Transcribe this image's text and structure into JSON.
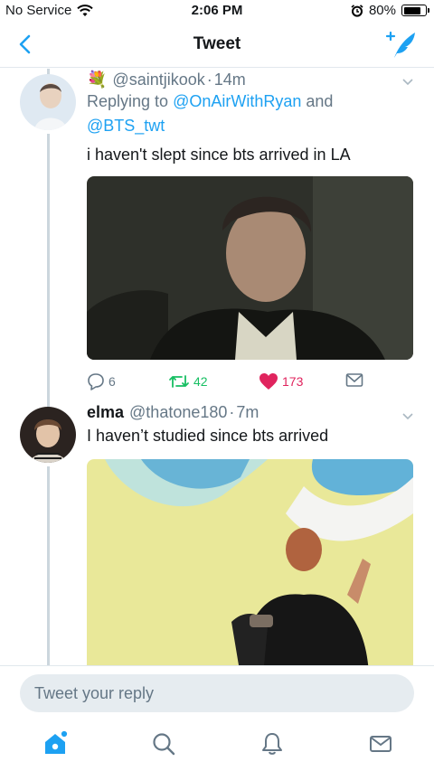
{
  "status_bar": {
    "carrier": "No Service",
    "time": "2:06 PM",
    "battery": "80%",
    "battery_level": 0.8
  },
  "header": {
    "title": "Tweet"
  },
  "tweets": [
    {
      "emoji": "💐",
      "handle": "@saintjikook",
      "time": "14m",
      "replying_prefix": "Replying to ",
      "replying_to_1": "@OnAirWithRyan",
      "replying_and": " and",
      "replying_to_2": "@BTS_twt",
      "text": "i haven't slept since bts arrived in LA",
      "replies": "6",
      "retweets": "42",
      "likes": "173"
    },
    {
      "name": "elma",
      "handle": "@thatone180",
      "time": "7m",
      "text": "I haven’t studied since bts arrived"
    }
  ],
  "composer": {
    "placeholder": "Tweet your reply"
  },
  "colors": {
    "accent": "#1da1f2",
    "retweet": "#17bf63",
    "like": "#e0245e",
    "muted": "#657786"
  }
}
